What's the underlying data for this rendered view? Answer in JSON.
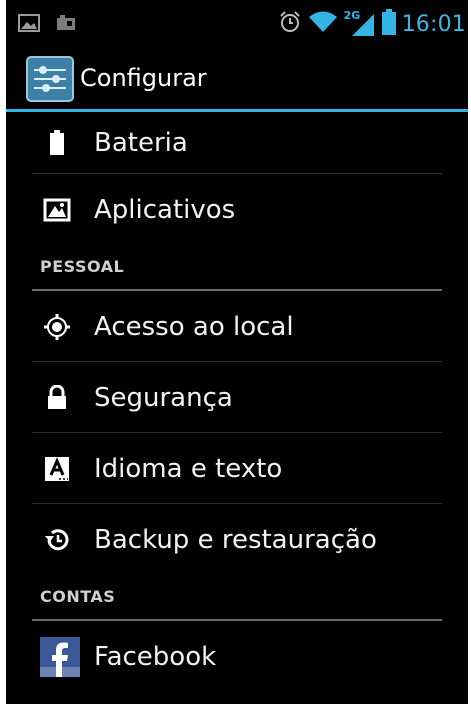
{
  "status_bar": {
    "time": "16:01",
    "network": "2G",
    "icons": [
      "image-notification-icon",
      "sd-card-icon",
      "alarm-icon",
      "wifi-icon",
      "signal-icon",
      "battery-icon"
    ]
  },
  "action_bar": {
    "title": "Configurar",
    "app_icon": "settings-sliders-icon"
  },
  "items": [
    {
      "label": "Bateria",
      "icon": "battery-icon"
    },
    {
      "label": "Aplicativos",
      "icon": "apps-icon"
    }
  ],
  "sections": [
    {
      "title": "PESSOAL",
      "items": [
        {
          "label": "Acesso ao local",
          "icon": "location-icon"
        },
        {
          "label": "Segurança",
          "icon": "lock-icon"
        },
        {
          "label": "Idioma e texto",
          "icon": "language-icon"
        },
        {
          "label": "Backup e restauração",
          "icon": "backup-restore-icon"
        }
      ]
    },
    {
      "title": "CONTAS",
      "items": [
        {
          "label": "Facebook",
          "icon": "facebook-icon"
        }
      ]
    }
  ],
  "colors": {
    "accent": "#33b5e5",
    "background": "#000000",
    "text": "#f2f2f2"
  }
}
